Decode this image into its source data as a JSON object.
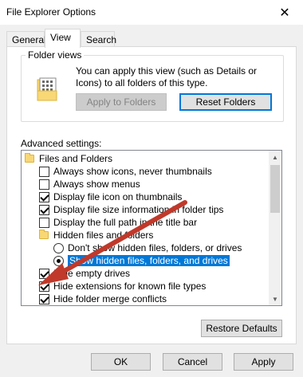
{
  "window": {
    "title": "File Explorer Options",
    "close_glyph": "✕"
  },
  "tabs": [
    {
      "label": "General"
    },
    {
      "label": "View"
    },
    {
      "label": "Search"
    }
  ],
  "folder_views": {
    "group_label": "Folder views",
    "description": "You can apply this view (such as Details or Icons) to all folders of this type.",
    "apply_button": "Apply to Folders",
    "reset_button": "Reset Folders"
  },
  "advanced": {
    "label": "Advanced settings:",
    "items": [
      {
        "type": "folder",
        "label": "Files and Folders"
      },
      {
        "type": "checkbox",
        "checked": false,
        "label": "Always show icons, never thumbnails"
      },
      {
        "type": "checkbox",
        "checked": false,
        "label": "Always show menus"
      },
      {
        "type": "checkbox",
        "checked": true,
        "label": "Display file icon on thumbnails"
      },
      {
        "type": "checkbox",
        "checked": true,
        "label": "Display file size information in folder tips"
      },
      {
        "type": "checkbox",
        "checked": false,
        "label": "Display the full path in the title bar"
      },
      {
        "type": "folder",
        "label": "Hidden files and folders"
      },
      {
        "type": "radio",
        "selected": false,
        "label": "Don't show hidden files, folders, or drives"
      },
      {
        "type": "radio",
        "selected": true,
        "label": "Show hidden files, folders, and drives"
      },
      {
        "type": "checkbox",
        "checked": true,
        "label": "Hide empty drives"
      },
      {
        "type": "checkbox",
        "checked": true,
        "label": "Hide extensions for known file types"
      },
      {
        "type": "checkbox",
        "checked": true,
        "label": "Hide folder merge conflicts"
      }
    ]
  },
  "restore_button": "Restore Defaults",
  "footer": {
    "ok": "OK",
    "cancel": "Cancel",
    "apply": "Apply"
  },
  "colors": {
    "arrow": "#c0392b",
    "selection": "#0078d7"
  }
}
